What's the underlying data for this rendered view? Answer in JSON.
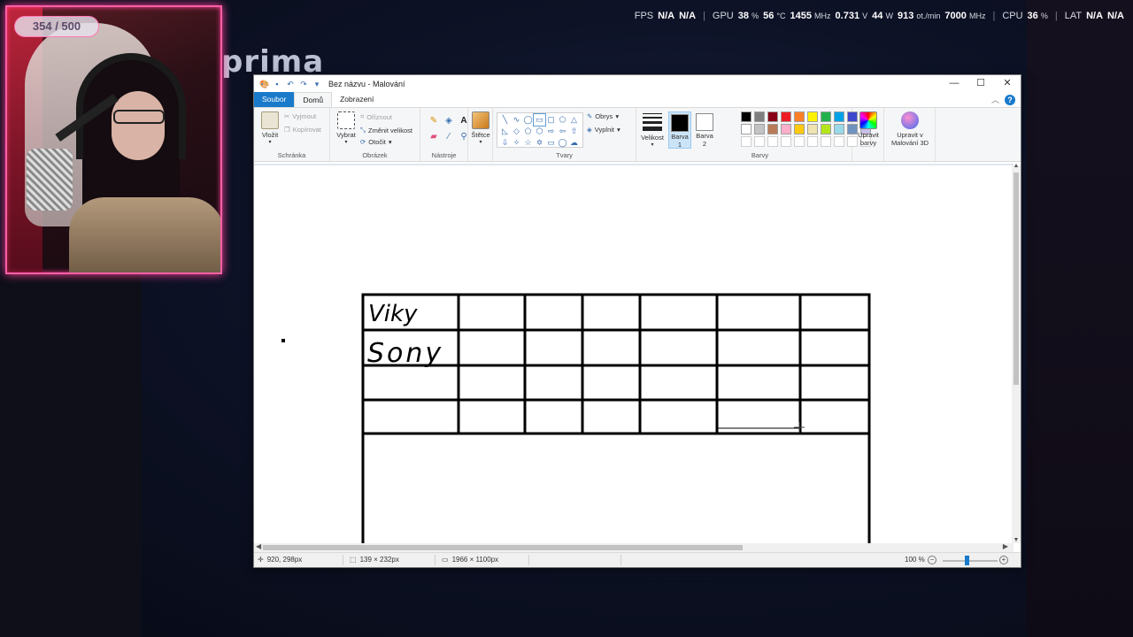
{
  "background": {
    "brand_text": "prima"
  },
  "overlay_stats": {
    "fps_label": "FPS",
    "fps_value1": "N/A",
    "fps_value2": "N/A",
    "gpu_label": "GPU",
    "gpu_load": "38",
    "gpu_load_unit": "%",
    "gpu_temp": "56",
    "gpu_temp_unit": "°C",
    "gpu_clock": "1455",
    "gpu_clock_unit": "MHz",
    "gpu_voltage": "0.731",
    "gpu_voltage_unit": "V",
    "gpu_power": "44",
    "gpu_power_unit": "W",
    "gpu_fan": "913",
    "gpu_fan_unit": "ot./min",
    "gpu_mem_clock": "7000",
    "gpu_mem_clock_unit": "MHz",
    "cpu_label": "CPU",
    "cpu_load": "36",
    "cpu_load_unit": "%",
    "lat_label": "LAT",
    "lat_value1": "N/A",
    "lat_value2": "N/A"
  },
  "webcam": {
    "viewer_count": "354 / 500"
  },
  "paint": {
    "window_title": "Bez názvu - Malování",
    "window_controls": {
      "minimize": "—",
      "maximize": "☐",
      "close": "✕"
    },
    "quick_access": [
      "save",
      "undo",
      "redo",
      "customize"
    ],
    "tabs": [
      {
        "label": "Soubor"
      },
      {
        "label": "Domů"
      },
      {
        "label": "Zobrazení"
      }
    ],
    "help": "?",
    "ribbon": {
      "clipboard": {
        "paste_label": "Vložit",
        "cut_label": "Vyjmout",
        "copy_label": "Kopírovat",
        "group_label": "Schránka"
      },
      "image": {
        "select_label": "Vybrat",
        "crop_label": "Oříznout",
        "resize_label": "Změnit velikost",
        "rotate_label": "Otočit",
        "group_label": "Obrázek"
      },
      "tools": {
        "group_label": "Nástroje"
      },
      "brushes": {
        "label": "Štětce"
      },
      "shapes": {
        "outline_label": "Obrys",
        "fill_label": "Vyplnit",
        "group_label": "Tvary"
      },
      "size": {
        "label": "Velikost"
      },
      "colors": {
        "color1_label": "Barva",
        "color1_num": "1",
        "color2_label": "Barva",
        "color2_num": "2",
        "color1": "#000000",
        "color2": "#ffffff",
        "edit_label": "Upravit",
        "edit_label2": "barvy",
        "group_label": "Barvy",
        "palette_row1": [
          "#000000",
          "#7f7f7f",
          "#880015",
          "#ed1c24",
          "#ff7f27",
          "#fff200",
          "#22b14c",
          "#00a2e8",
          "#3f48cc",
          "#a349a4"
        ],
        "palette_row2": [
          "#ffffff",
          "#c3c3c3",
          "#b97a57",
          "#ffaec9",
          "#ffc90e",
          "#efe4b0",
          "#b5e61d",
          "#99d9ea",
          "#7092be",
          "#c8bfe7"
        ],
        "palette_row3": [
          "#ffffff",
          "#ffffff",
          "#ffffff",
          "#ffffff",
          "#ffffff",
          "#ffffff",
          "#ffffff",
          "#ffffff",
          "#ffffff",
          "#ffffff"
        ]
      },
      "paint3d": {
        "label1": "Upravit v",
        "label2": "Malování 3D"
      }
    },
    "canvas": {
      "handwriting": [
        "Viky",
        "Sony"
      ]
    },
    "status": {
      "cursor_pos": "920, 298px",
      "selection_size": "139 × 232px",
      "image_size": "1966 × 1100px",
      "zoom": "100 %"
    }
  }
}
